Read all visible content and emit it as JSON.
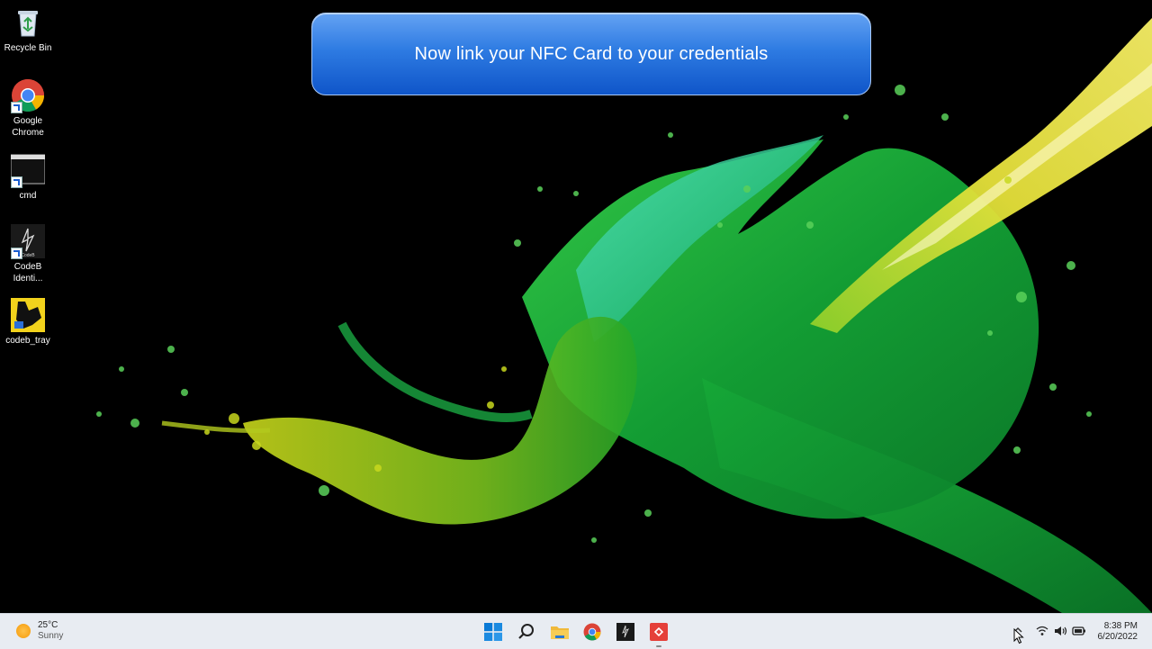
{
  "banner": {
    "text": "Now link your NFC Card to your credentials"
  },
  "desktop": {
    "icons": [
      {
        "label": "Recycle Bin"
      },
      {
        "label": "Google Chrome"
      },
      {
        "label": "cmd"
      },
      {
        "label": "CodeB Identi..."
      },
      {
        "label": "codeb_tray"
      }
    ],
    "codeb_logo_text": "CodeB"
  },
  "taskbar": {
    "weather": {
      "temp": "25°C",
      "condition": "Sunny"
    },
    "pinned": [
      "start-icon",
      "search-icon",
      "file-explorer-icon",
      "chrome-icon",
      "codeb-identity-icon",
      "codeb-tray-app-icon"
    ],
    "tray": [
      "show-hidden-icons-chevron",
      "wifi-icon",
      "volume-icon",
      "battery-icon"
    ],
    "clock": {
      "time": "8:38 PM",
      "date": "6/20/2022"
    }
  },
  "colors": {
    "banner_top": "#64a2f3",
    "banner_bottom": "#0f55c9",
    "taskbar": "#e8ecf2"
  }
}
